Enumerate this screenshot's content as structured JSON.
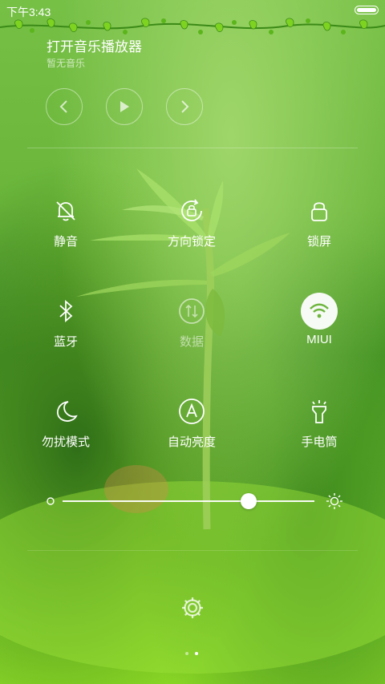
{
  "status_bar": {
    "time": "下午3:43"
  },
  "music": {
    "title": "打开音乐播放器",
    "subtitle": "暂无音乐"
  },
  "toggles": [
    {
      "label": "静音",
      "icon": "bell-off-icon",
      "active": false,
      "dimmed": false
    },
    {
      "label": "方向锁定",
      "icon": "rotation-lock-icon",
      "active": false,
      "dimmed": false
    },
    {
      "label": "锁屏",
      "icon": "lock-icon",
      "active": false,
      "dimmed": false
    },
    {
      "label": "蓝牙",
      "icon": "bluetooth-icon",
      "active": false,
      "dimmed": false
    },
    {
      "label": "数据",
      "icon": "mobile-data-icon",
      "active": false,
      "dimmed": true
    },
    {
      "label": "MIUI",
      "icon": "wifi-icon",
      "active": true,
      "dimmed": false
    },
    {
      "label": "勿扰模式",
      "icon": "moon-icon",
      "active": false,
      "dimmed": false
    },
    {
      "label": "自动亮度",
      "icon": "auto-brightness-icon",
      "active": false,
      "dimmed": false
    },
    {
      "label": "手电筒",
      "icon": "flashlight-icon",
      "active": false,
      "dimmed": false
    }
  ],
  "brightness": {
    "level": 0.74
  },
  "pager": {
    "count": 2,
    "current": 1
  },
  "colors": {
    "wifi_active": "#6fb63f",
    "text": "#ffffff"
  }
}
